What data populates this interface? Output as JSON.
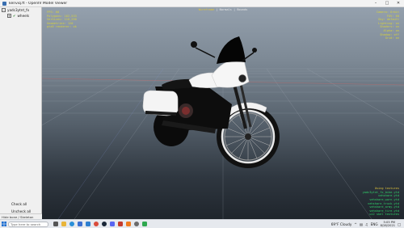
{
  "window": {
    "title": "kenviq.ft - OpenIV Model Viewer",
    "minimize_glyph": "–",
    "maximize_glyph": "□",
    "close_glyph": "✕"
  },
  "tree": {
    "root_label": "yadc3ytnt_fx",
    "root_expander": "−",
    "child_expander": "+",
    "child_label": "wheels",
    "child_check": "✔"
  },
  "panel": {
    "check_all": "Check all",
    "uncheck_all": "Uncheck all",
    "status": "Hide bone / Skeleton"
  },
  "hud": {
    "left_lines": [
      "FPS: 60",
      "Polygons: 162,533",
      "Vertices: 110,250",
      "Geometries: 120",
      "gta5 renderer: ok"
    ],
    "center_prefix": "",
    "center_highlight": "Wireframe",
    "center_suffix": " | Normals | Bounds",
    "right_lines": [
      "Camera: Orbit",
      "FOV: 60",
      "Sky: default",
      "Lighting: on",
      "Shaders: on",
      "Alpha: on",
      "Shadow: off",
      "Grid: on"
    ],
    "bottom_title": "Using textures",
    "bottom_lines": [
      "yadc3ytnt_fx_bike.ytd",
      "vehshare.ytd",
      "vehshare_worn.ytd",
      "vehshare_truck.ytd",
      "vehshare_army.ytd",
      "vehshare_tire.ytd",
      "ui2 skel textures"
    ]
  },
  "taskbar": {
    "search_placeholder": "Type here to search",
    "weather": "69°F  Cloudy",
    "language": "ENG",
    "time": "5:05 PM",
    "date": "8/28/2021"
  },
  "colors": {
    "hud_yellow": "#d8d23a",
    "hud_green": "#2fd46a",
    "viewport_top": "#94a0ad",
    "viewport_bottom": "#1f252c"
  }
}
